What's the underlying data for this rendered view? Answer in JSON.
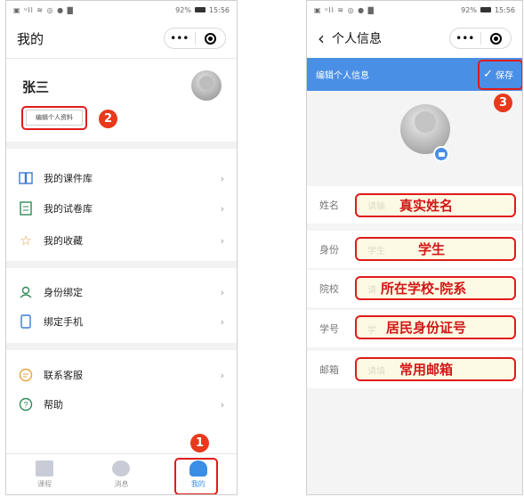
{
  "status_bar": {
    "left": "▣ ᵘll ≋ ◎ ● ▇",
    "battery_pct": "92%",
    "time": "15:56"
  },
  "capsule": {
    "more": "•••"
  },
  "screen1": {
    "title": "我的",
    "user_name": "张三",
    "edit_profile_label": "编辑个人资料",
    "callout_2": "2",
    "callout_1": "1",
    "menu": [
      {
        "label": "我的课件库"
      },
      {
        "label": "我的试卷库"
      },
      {
        "label": "我的收藏"
      },
      {
        "label": "身份绑定"
      },
      {
        "label": "绑定手机"
      },
      {
        "label": "联系客服"
      },
      {
        "label": "帮助"
      }
    ],
    "chevron": "›",
    "tabs": [
      {
        "label": "课程"
      },
      {
        "label": "消息"
      },
      {
        "label": "我的"
      }
    ]
  },
  "screen2": {
    "back": "‹",
    "title": "个人信息",
    "header_label": "编辑个人信息",
    "save_label": "保存",
    "callout_3": "3",
    "fields": [
      {
        "label": "姓名",
        "placeholder": "请输",
        "annotation": "真实姓名"
      },
      {
        "label": "身份",
        "placeholder": "学生",
        "annotation": "学生"
      },
      {
        "label": "院校",
        "placeholder": "请",
        "annotation": "所在学校-院系"
      },
      {
        "label": "学号",
        "placeholder": "学",
        "annotation": "居民身份证号"
      },
      {
        "label": "邮箱",
        "placeholder": "请填",
        "annotation": "常用邮箱"
      }
    ]
  },
  "colors": {
    "accent": "#4a8fe6",
    "callout": "#e8391c",
    "highlight": "#e01b1b",
    "active_tab": "#3a8ee6"
  }
}
